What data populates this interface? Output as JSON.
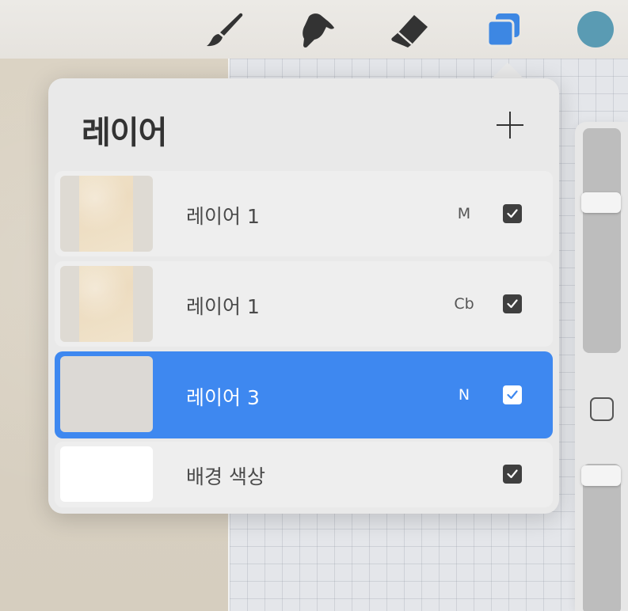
{
  "toolbar": {
    "icons": [
      "brush-icon",
      "smudge-icon",
      "eraser-icon",
      "layers-icon"
    ],
    "active_color": "#5a9bb3",
    "layers_icon_color": "#3d87e3"
  },
  "layers_panel": {
    "title": "레이어",
    "add_icon": "plus-icon",
    "layers": [
      {
        "name": "레이어 1",
        "blend_mode": "M",
        "visible": true,
        "selected": false,
        "thumbnail": "paper"
      },
      {
        "name": "레이어 1",
        "blend_mode": "Cb",
        "visible": true,
        "selected": false,
        "thumbnail": "paper"
      },
      {
        "name": "레이어 3",
        "blend_mode": "N",
        "visible": true,
        "selected": true,
        "thumbnail": "blank"
      },
      {
        "name": "배경 색상",
        "blend_mode": "",
        "visible": true,
        "selected": false,
        "thumbnail": "white"
      }
    ],
    "accent_color": "#3e88f0"
  },
  "sidebar": {
    "brush_size_level": 0.35,
    "opacity_level": 0.95
  }
}
